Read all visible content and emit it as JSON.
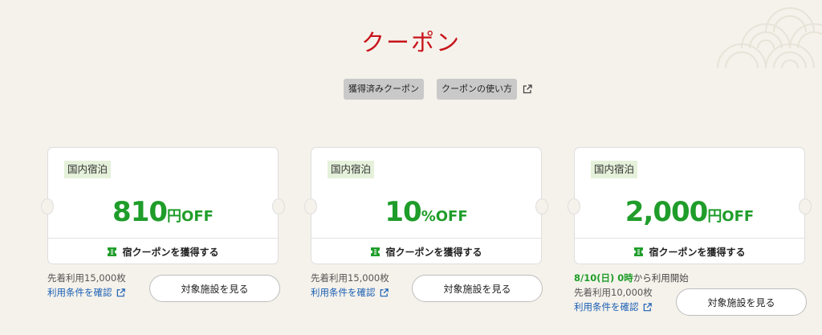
{
  "title": "クーポン",
  "links": {
    "acquired": "獲得済みクーポン",
    "how_to": "クーポンの使い方"
  },
  "coupons": [
    {
      "category": "国内宿泊",
      "amount": "810",
      "unit": "円OFF",
      "get_label": "宿クーポンを獲得する",
      "start_date": "",
      "start_rest": "",
      "limit": "先着利用15,000枚",
      "terms": "利用条件を確認",
      "button": "対象施設を見る"
    },
    {
      "category": "国内宿泊",
      "amount": "10",
      "unit": "%OFF",
      "get_label": "宿クーポンを獲得する",
      "start_date": "",
      "start_rest": "",
      "limit": "先着利用15,000枚",
      "terms": "利用条件を確認",
      "button": "対象施設を見る"
    },
    {
      "category": "国内宿泊",
      "amount": "2,000",
      "unit": "円OFF",
      "get_label": "宿クーポンを獲得する",
      "start_date": "8/10(日) 0時",
      "start_rest": "から利用開始",
      "limit": "先着利用10,000枚",
      "terms": "利用条件を確認",
      "button": "対象施設を見る"
    }
  ],
  "colors": {
    "title": "#c8141c",
    "accent_green": "#1f9d2a",
    "link_blue": "#1a5fb4",
    "background": "#f5f2eb"
  }
}
